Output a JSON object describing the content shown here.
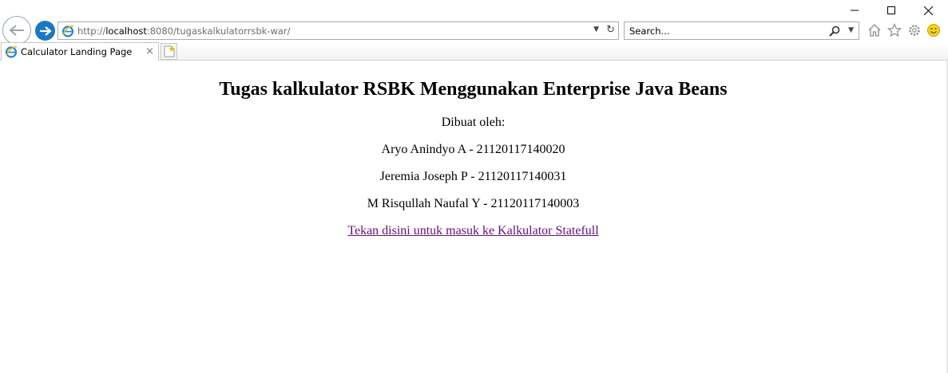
{
  "window": {
    "minimize_icon": "minimize-icon",
    "maximize_icon": "maximize-icon",
    "close_icon": "close-icon"
  },
  "nav": {
    "back_icon": "back-arrow-icon",
    "forward_icon": "forward-arrow-icon"
  },
  "address": {
    "url_prefix": "http://",
    "url_host": "localhost",
    "url_rest": ":8080/tugaskalkulatorrsbk-war/"
  },
  "search": {
    "placeholder": "Search..."
  },
  "tab": {
    "title": "Calculator Landing Page",
    "close": "×"
  },
  "page": {
    "heading": "Tugas kalkulator RSBK Menggunakan Enterprise Java Beans",
    "made_by": "Dibuat oleh:",
    "authors": [
      "Aryo Anindyo A - 21120117140020",
      "Jeremia Joseph P - 21120117140031",
      "M Risqullah Naufal Y - 21120117140003"
    ],
    "link_text": "Tekan disini untuk masuk ke Kalkulator Statefull"
  },
  "colors": {
    "link_visited": "#660e7a",
    "forward_button": "#1a78c2"
  }
}
